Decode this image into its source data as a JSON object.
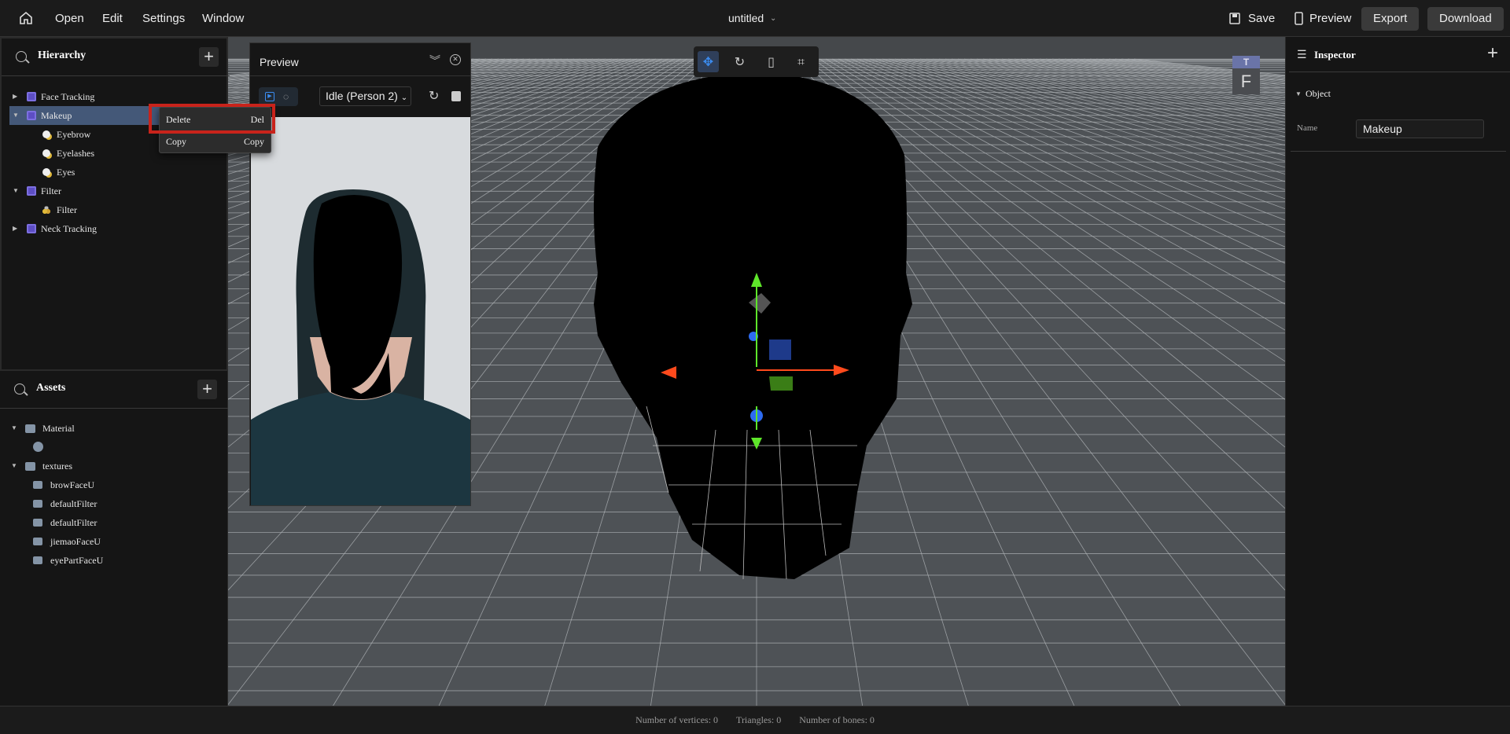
{
  "topbar": {
    "menu": [
      "Open",
      "Edit",
      "Settings",
      "Window"
    ],
    "title": "untitled",
    "save": "Save",
    "preview": "Preview",
    "export": "Export",
    "download": "Download"
  },
  "hierarchy": {
    "title": "Hierarchy",
    "items": [
      {
        "label": "Face Tracking",
        "icon": "tracking-icon",
        "level": 0,
        "expanded": false
      },
      {
        "label": "Makeup",
        "icon": "tracking-icon",
        "level": 0,
        "expanded": true,
        "selected": true
      },
      {
        "label": "Eyebrow",
        "icon": "makeup-icon",
        "level": 1
      },
      {
        "label": "Eyelashes",
        "icon": "makeup-icon",
        "level": 1
      },
      {
        "label": "Eyes",
        "icon": "makeup-icon",
        "level": 1
      },
      {
        "label": "Filter",
        "icon": "tracking-icon",
        "level": 0,
        "expanded": true
      },
      {
        "label": "Filter",
        "icon": "filter-icon",
        "level": 1
      },
      {
        "label": "Neck Tracking",
        "icon": "tracking-icon",
        "level": 0,
        "expanded": false
      }
    ]
  },
  "context_menu": {
    "items": [
      {
        "label": "Delete",
        "shortcut": "Del"
      },
      {
        "label": "Copy",
        "shortcut": "Copy"
      }
    ]
  },
  "assets": {
    "title": "Assets",
    "items": [
      {
        "label": "Material",
        "type": "folder",
        "level": 0
      },
      {
        "label": "",
        "type": "material",
        "level": 1
      },
      {
        "label": "textures",
        "type": "folder",
        "level": 0
      },
      {
        "label": "browFaceU",
        "type": "image",
        "level": 1
      },
      {
        "label": "defaultFilter",
        "type": "image",
        "level": 1
      },
      {
        "label": "defaultFilter",
        "type": "image",
        "level": 1
      },
      {
        "label": "jiemaoFaceU",
        "type": "image",
        "level": 1
      },
      {
        "label": "eyePartFaceU",
        "type": "image",
        "level": 1
      }
    ]
  },
  "preview": {
    "title": "Preview",
    "animation": "Idle (Person 2)"
  },
  "viewport": {
    "view_cube": {
      "top": "T",
      "front": "F"
    }
  },
  "inspector": {
    "title": "Inspector",
    "section": "Object",
    "name_label": "Name",
    "name_value": "Makeup"
  },
  "status": {
    "vertices": "Number of vertices: 0",
    "triangles": "Triangles: 0",
    "bones": "Number of bones: 0"
  },
  "colors": {
    "selection": "#445878",
    "accent": "#3b8cf0",
    "highlight_box": "#c8231b",
    "axis_x": "#ff4a1c",
    "axis_y": "#5ee62a",
    "axis_z": "#2d6bf0"
  }
}
